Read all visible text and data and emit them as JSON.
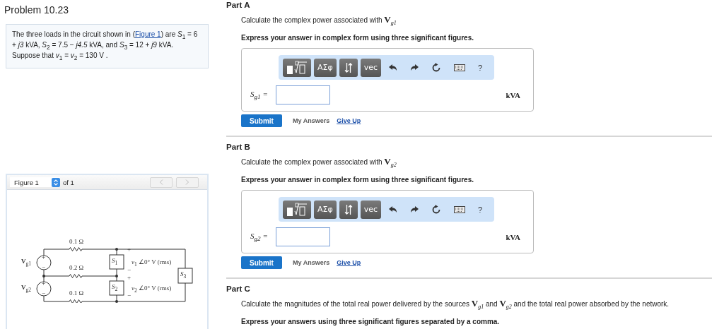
{
  "problem": {
    "title": "Problem 10.23",
    "intro": "The three loads in the circuit shown in (",
    "link": "Figure 1",
    "statement": ") are *S*$_{1}$ = 6 + *j3* kVA, *S*$_{2}$ = 7.5 − *j4.5* kVA, and *S*$_{3}$ = 12 + *j9* kVA. Suppose that *v*$_{1}$ = *v*$_{2}$ = 130  V ."
  },
  "figure": {
    "select": "Figure 1",
    "of": "of 1",
    "circuit": {
      "resistors": [
        "0.1 Ω",
        "0.2 Ω",
        "0.1 Ω"
      ],
      "sources": [
        "**V**$_{g1}$",
        "**V**$_{g2}$"
      ],
      "source_signs": [
        "+",
        "−",
        "+",
        "−"
      ],
      "loads": [
        "*S*$_{1}$",
        "*S*$_{2}$",
        "*S*$_{3}$"
      ],
      "polarity": [
        "+",
        "−",
        "+",
        "−"
      ],
      "voltages": [
        "*v*$_{1}$ ∠0° V (rms)",
        "*v*$_{2}$ ∠0° V (rms)"
      ]
    }
  },
  "parts": [
    {
      "title": "Part A",
      "prompt": "Calculate the complex power associated with **V**$_{g1}$",
      "instruction": "Express your answer in complex form using three significant figures.",
      "toolbar": [
        "ΑΣφ",
        "vec",
        "?"
      ],
      "answer_label": "*S*$_{g1}$ =",
      "unit": "kVA",
      "submit": "Submit",
      "my_answers": "My Answers",
      "give_up": "Give Up"
    },
    {
      "title": "Part B",
      "prompt": "Calculate the complex power associated with **V**$_{g2}$",
      "instruction": "Express your answer in complex form using three significant figures.",
      "toolbar": [
        "ΑΣφ",
        "vec",
        "?"
      ],
      "answer_label": "*S*$_{g2}$ =",
      "unit": "kVA",
      "submit": "Submit",
      "my_answers": "My Answers",
      "give_up": "Give Up"
    },
    {
      "title": "Part C",
      "prompt": "Calculate the magnitudes of the total real power delivered by the sources **V**$_{g1}$ and **V**$_{g2}$ and the total real power absorbed by the network.",
      "instruction": "Express your answers using three significant figures separated by a comma."
    }
  ]
}
